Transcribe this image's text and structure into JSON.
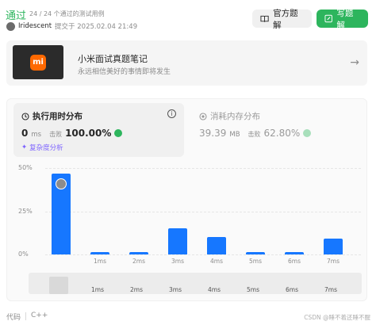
{
  "header": {
    "status": "通过",
    "passed_cases": "24 / 24 个通过的测试用例",
    "username": "Iridescent",
    "submit_time": "提交于 2025.02.04 21:49"
  },
  "buttons": {
    "official_solution": "官方题解",
    "write_solution": "写题解"
  },
  "note": {
    "logo_text": "mi",
    "title": "小米面试真题笔记",
    "subtitle": "永远相信美好的事情即将发生"
  },
  "runtime": {
    "title": "执行用时分布",
    "value": "0",
    "unit": "ms",
    "beat_label": "击败",
    "beat_percent": "100.00%",
    "analysis": "复杂度分析"
  },
  "memory": {
    "title": "消耗内存分布",
    "value": "39.39",
    "unit": "MB",
    "beat_label": "击败",
    "beat_percent": "62.80%"
  },
  "chart_data": {
    "type": "bar",
    "categories": [
      "0ms",
      "1ms",
      "2ms",
      "3ms",
      "4ms",
      "5ms",
      "6ms",
      "7ms"
    ],
    "x_tick_labels": [
      "",
      "1ms",
      "2ms",
      "3ms",
      "4ms",
      "5ms",
      "6ms",
      "7ms"
    ],
    "values": [
      47,
      1.5,
      1.5,
      15,
      10,
      1.5,
      1.5,
      9
    ],
    "y_ticks": [
      "50%",
      "25%",
      "0%"
    ],
    "ylim": [
      0,
      50
    ],
    "highlight_category": "0ms",
    "bar_color": "#1677ff"
  },
  "scroller_labels": [
    "1ms",
    "2ms",
    "3ms",
    "4ms",
    "5ms",
    "6ms",
    "7ms"
  ],
  "footer": {
    "code_label": "代码",
    "language": "C++"
  },
  "watermark": "CSDN @睡不着还睡不醒",
  "colors": {
    "accent_green": "#2db55d",
    "bar_blue": "#1677ff",
    "purple": "#7b61ff"
  }
}
